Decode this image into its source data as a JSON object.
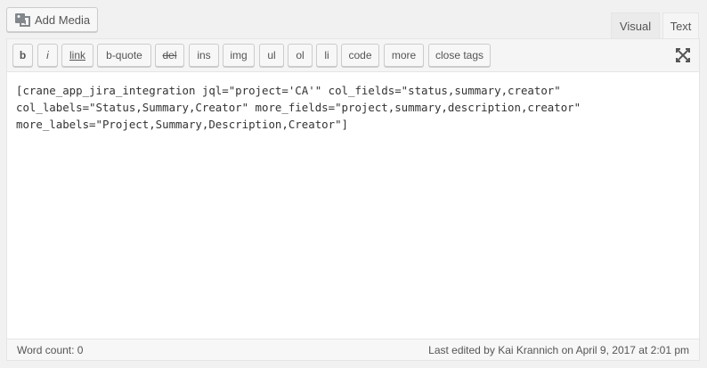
{
  "media": {
    "add_media_label": "Add Media",
    "icon": "media-icon"
  },
  "tabs": {
    "visual": "Visual",
    "text": "Text"
  },
  "toolbar": {
    "buttons": [
      "b",
      "i",
      "link",
      "b-quote",
      "del",
      "ins",
      "img",
      "ul",
      "ol",
      "li",
      "code",
      "more",
      "close tags"
    ],
    "fullscreen_icon": "fullscreen-icon"
  },
  "content": {
    "text": "[crane_app_jira_integration jql=\"project='CA'\" col_fields=\"status,summary,creator\"\ncol_labels=\"Status,Summary,Creator\" more_fields=\"project,summary,description,creator\"\nmore_labels=\"Project,Summary,Description,Creator\"]"
  },
  "status": {
    "word_count": "Word count: 0",
    "last_edited": "Last edited by Kai Krannich on April 9, 2017 at 2:01 pm"
  }
}
